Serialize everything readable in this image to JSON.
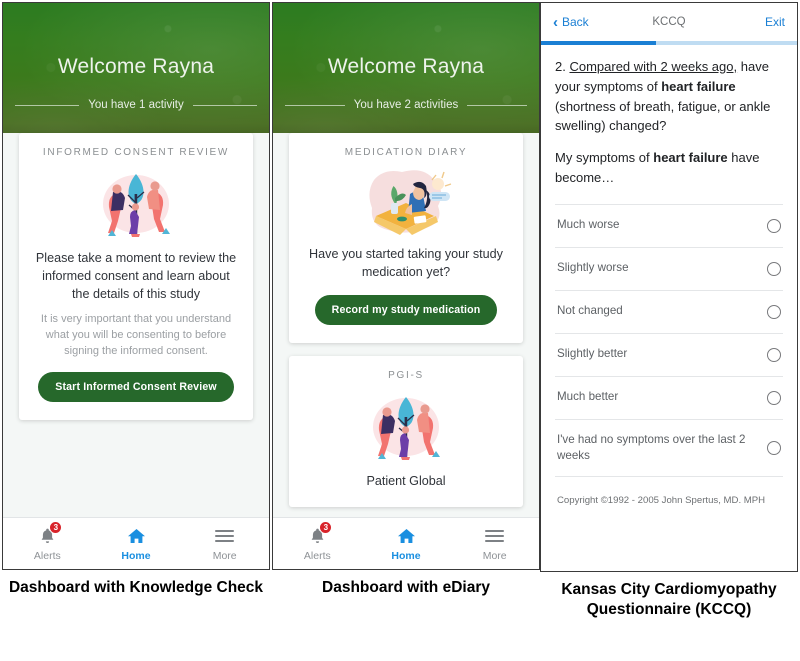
{
  "panels": [
    {
      "caption": "Dashboard with Knowledge Check",
      "header": {
        "welcome": "Welcome Rayna",
        "activity": "You have 1 activity"
      },
      "cards": [
        {
          "kicker": "INFORMED CONSENT REVIEW",
          "headline": "Please take a moment to review the informed consent and learn about the details of this study",
          "sub": "It is very important that you understand what you will be consenting to before signing the informed consent.",
          "button": "Start Informed Consent Review"
        }
      ],
      "nav": [
        {
          "label": "Alerts",
          "icon": "bell-icon",
          "badge": "3",
          "active": false
        },
        {
          "label": "Home",
          "icon": "home-icon",
          "active": true
        },
        {
          "label": "More",
          "icon": "hamburger-icon",
          "active": false
        }
      ]
    },
    {
      "caption": "Dashboard with eDiary",
      "header": {
        "welcome": "Welcome Rayna",
        "activity": "You have 2 activities"
      },
      "cards": [
        {
          "kicker": "MEDICATION DIARY",
          "headline": "Have you started taking your study medication yet?",
          "button": "Record my study medication"
        },
        {
          "kicker": "PGI-S",
          "headline": "Patient Global"
        }
      ],
      "nav": [
        {
          "label": "Alerts",
          "icon": "bell-icon",
          "badge": "3",
          "active": false
        },
        {
          "label": "Home",
          "icon": "home-icon",
          "active": true
        },
        {
          "label": "More",
          "icon": "hamburger-icon",
          "active": false
        }
      ]
    }
  ],
  "kccq": {
    "caption": "Kansas City Cardiomyopathy Questionnaire (KCCQ)",
    "topbar": {
      "back": "Back",
      "title": "KCCQ",
      "exit": "Exit",
      "progress_percent": 45
    },
    "question": {
      "number": "2.",
      "underlined": "Compared with 2 weeks ago,",
      "part_a": " have your symptoms of ",
      "bold_a": "heart failure",
      "part_b": " (shortness of breath, fatigue, or ankle swelling) changed?",
      "prompt_a": "My symptoms of ",
      "prompt_bold": "heart failure",
      "prompt_b": " have become…"
    },
    "options": [
      "Much worse",
      "Slightly worse",
      "Not changed",
      "Slightly better",
      "Much better",
      "I've had no symptoms over the last 2 weeks"
    ],
    "copyright": "Copyright ©1992 - 2005 John Spertus, MD. MPH"
  },
  "colors": {
    "brand_green": "#26682b",
    "accent_blue": "#1a7fd4",
    "badge_red": "#d8232a",
    "header_green_top": "#2c7c21",
    "header_green_bottom": "#2c3420"
  }
}
